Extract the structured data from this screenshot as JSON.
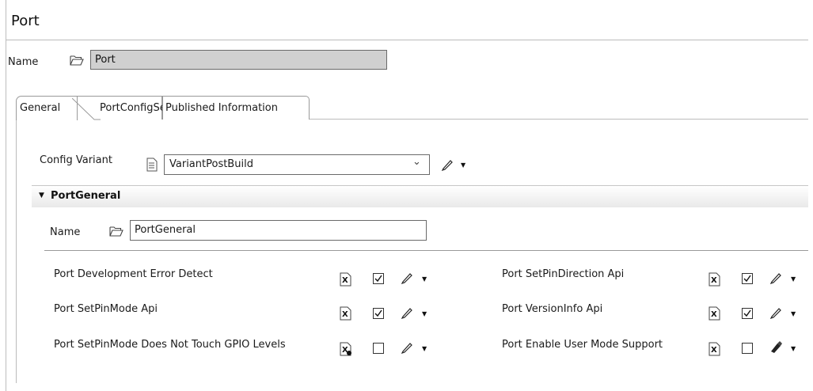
{
  "title": "Port",
  "name": {
    "label": "Name",
    "value": "Port"
  },
  "tabs": [
    {
      "label": "General",
      "active": true
    },
    {
      "label": "PortConfigSet",
      "active": false
    },
    {
      "label": "Published Information",
      "active": false
    }
  ],
  "config_variant": {
    "label": "Config Variant",
    "value": "VariantPostBuild"
  },
  "section": {
    "title": "PortGeneral",
    "expanded": true,
    "name_label": "Name",
    "name_value": "PortGeneral"
  },
  "params": [
    {
      "label": "Port Development Error Detect",
      "checked": true
    },
    {
      "label": "Port SetPinDirection Api",
      "checked": true
    },
    {
      "label": "Port SetPinMode Api",
      "checked": true
    },
    {
      "label": "Port VersionInfo Api",
      "checked": true
    },
    {
      "label": "Port SetPinMode Does Not Touch GPIO Levels",
      "checked": false
    },
    {
      "label": "Port Enable User Mode Support",
      "checked": false
    }
  ],
  "icons": {
    "folder": "folder-open-icon",
    "document": "document-icon",
    "edit": "pencil-icon",
    "dropdown": "dropdown-arrow-icon",
    "param_type": "x-document-icon"
  }
}
